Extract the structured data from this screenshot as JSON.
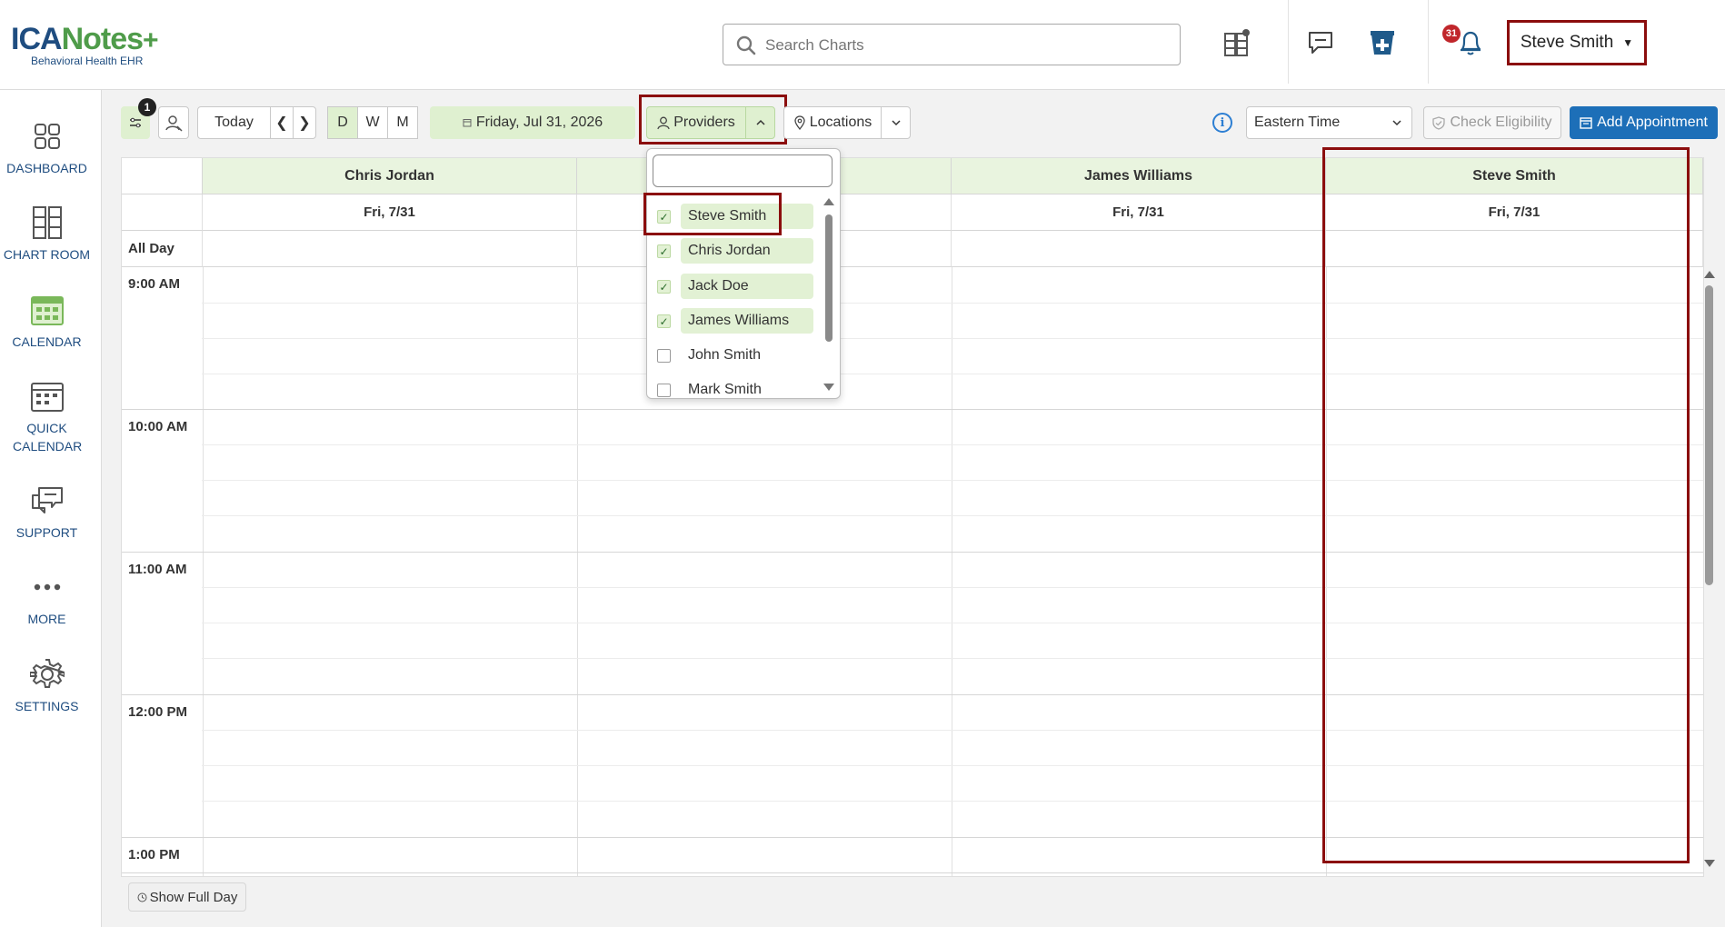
{
  "logo": {
    "ica": "ICA",
    "notes": "Notes",
    "plus": "+",
    "subtitle": "Behavioral Health EHR"
  },
  "header": {
    "search_placeholder": "Search Charts",
    "notification_count": "31",
    "user_name": "Steve Smith"
  },
  "sidebar": {
    "items": [
      {
        "label": "DASHBOARD",
        "icon": "dashboard-icon"
      },
      {
        "label": "CHART ROOM",
        "icon": "chart-room-icon"
      },
      {
        "label": "CALENDAR",
        "icon": "calendar-icon"
      },
      {
        "label": "QUICK CALENDAR",
        "icon": "quick-calendar-icon"
      },
      {
        "label": "SUPPORT",
        "icon": "support-icon"
      },
      {
        "label": "MORE",
        "icon": "more-icon"
      },
      {
        "label": "SETTINGS",
        "icon": "settings-icon"
      }
    ]
  },
  "toolbar": {
    "filter_badge": "1",
    "today_label": "Today",
    "view_day": "D",
    "view_week": "W",
    "view_month": "M",
    "current_date": "Friday, Jul 31, 2026",
    "providers_label": "Providers",
    "locations_label": "Locations",
    "timezone": "Eastern Time",
    "check_eligibility_label": "Check Eligibility",
    "add_appointment_label": "Add Appointment"
  },
  "calendar": {
    "columns": [
      {
        "provider": "Chris Jordan",
        "date": "Fri, 7/31"
      },
      {
        "provider": "",
        "date": ""
      },
      {
        "provider": "James Williams",
        "date": "Fri, 7/31"
      },
      {
        "provider": "Steve Smith",
        "date": "Fri, 7/31"
      }
    ],
    "all_day_label": "All Day",
    "time_labels": [
      "9:00 AM",
      "10:00 AM",
      "11:00 AM",
      "12:00 PM",
      "1:00 PM"
    ]
  },
  "providers_dropdown": {
    "search_value": "",
    "items": [
      {
        "name": "Steve Smith",
        "checked": true
      },
      {
        "name": "Chris Jordan",
        "checked": true
      },
      {
        "name": "Jack Doe",
        "checked": true
      },
      {
        "name": "James Williams",
        "checked": true
      },
      {
        "name": "John Smith",
        "checked": false
      },
      {
        "name": "Mark Smith",
        "checked": false
      }
    ]
  },
  "footer": {
    "show_full_day_label": "Show Full Day"
  },
  "colors": {
    "brand_blue": "#1f4d80",
    "brand_green": "#4f9c4a",
    "highlight_red": "#8b0d0d",
    "accent_green_bg": "#dff0d0",
    "primary_button": "#1d6fb8"
  }
}
